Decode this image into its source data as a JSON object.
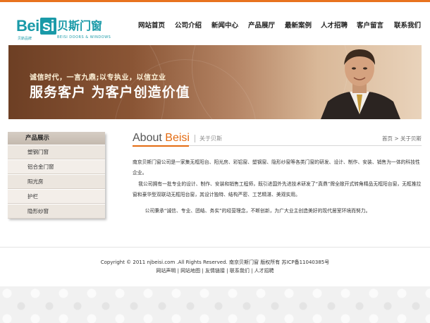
{
  "logo": {
    "brand": "Bei",
    "brand_box": "si",
    "cn_name": "贝斯门窗",
    "sub_cn": "贝斯品牌",
    "sub_en": "BEISI DOORS & WINDOWS"
  },
  "nav": [
    {
      "label": "网站首页"
    },
    {
      "label": "公司介绍"
    },
    {
      "label": "新闻中心"
    },
    {
      "label": "产品展厅"
    },
    {
      "label": "最新案例"
    },
    {
      "label": "人才招聘"
    },
    {
      "label": "客户留言"
    },
    {
      "label": "联系我们"
    }
  ],
  "banner": {
    "slogan_small": "诚信时代，一言九鼎;以专执业，以信立业",
    "slogan_big": "服务客户  为客户创造价值"
  },
  "sidebar": {
    "title": "产品展示",
    "items": [
      {
        "label": "塑钢门窗"
      },
      {
        "label": "铝合金门窗"
      },
      {
        "label": "阳光房"
      },
      {
        "label": "护栏"
      },
      {
        "label": "隐形纱窗"
      }
    ]
  },
  "section": {
    "title_prefix": "About ",
    "title_accent": "Beisi",
    "subtitle": "关于贝斯",
    "breadcrumb": "首页 > 关于贝斯"
  },
  "content": {
    "p1": "南京贝斯门窗公司是一家集无框阳台、阳光房、彩铝窗、塑钢窗、隐形纱窗等各类门窗的研发、设计、制作、安装、销售为一体的科技性企业。",
    "p2": "我公司拥有一批专业的设计、制作、安装和销售工程师，既引进国外先进技术研发了“真鼎”牌全敞开式转角精品无框阳台窗，无框推拉窗和豪华型双联动无框阳台窗，其设计独特、结构严密、工艺精湛、美观实用。",
    "p3": "公司秉承“诚信、专业、团结、务实”的经营理念，不断创新，为广大业主创造美好的现代居室环境而努力。"
  },
  "footer": {
    "copyright": "Copyright © 2011 njbeisi.com .All Rights Reserved. 南京贝斯门窗  版权所有  苏ICP备11040385号",
    "links": [
      {
        "label": "网站声明"
      },
      {
        "label": "网站地图"
      },
      {
        "label": "友情链接"
      },
      {
        "label": "联系我们"
      },
      {
        "label": "人才招聘"
      }
    ],
    "separator": "|"
  },
  "colors": {
    "accent": "#e46b11",
    "brand": "#1a9aa8"
  }
}
